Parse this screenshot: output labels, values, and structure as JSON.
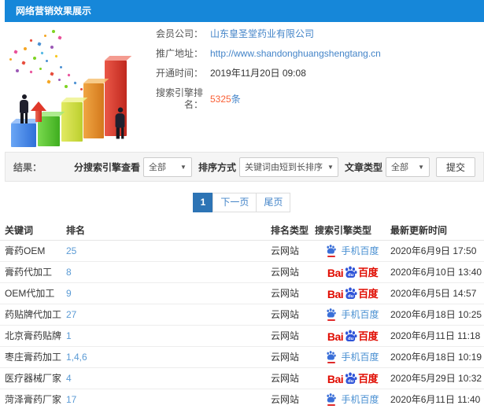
{
  "header": {
    "title": "网络营销效果展示"
  },
  "info": {
    "company_label": "会员公司：",
    "company_value": "山东皇圣堂药业有限公司",
    "url_label": "推广地址：",
    "url_value": "http://www.shandonghuangshengtang.cn",
    "opened_label": "开通时间：",
    "opened_value": "2019年11月20日 09:08",
    "rank_label": "搜索引擎排名：",
    "rank_count": "5325",
    "rank_unit": "条"
  },
  "filters": {
    "result_label": "结果：",
    "engine_label": "分搜索引擎查看",
    "engine_value": "全部",
    "sort_label": "排序方式",
    "sort_value": "关键词由短到长排序",
    "article_label": "文章类型",
    "article_value": "全部",
    "submit_label": "提交",
    "caret": "▼"
  },
  "pagination": {
    "current": "1",
    "next_label": "下一页",
    "last_label": "尾页"
  },
  "baidu": {
    "pc_prefix": "Bai",
    "paw_du": "du",
    "pc_suffix": "百度",
    "mobile_label": "手机百度"
  },
  "table": {
    "headers": [
      "关键词",
      "排名",
      "排名类型",
      "搜索引擎类型",
      "最新更新时间"
    ],
    "rows": [
      {
        "keyword": "膏药OEM",
        "rank": "25",
        "rank_type": "云网站",
        "engine": "mobile",
        "updated": "2020年6月9日 17:50"
      },
      {
        "keyword": "膏药代加工",
        "rank": "8",
        "rank_type": "云网站",
        "engine": "pc",
        "updated": "2020年6月10日 13:40"
      },
      {
        "keyword": "OEM代加工",
        "rank": "9",
        "rank_type": "云网站",
        "engine": "pc",
        "updated": "2020年6月5日 14:57"
      },
      {
        "keyword": "药贴牌代加工",
        "rank": "27",
        "rank_type": "云网站",
        "engine": "mobile",
        "updated": "2020年6月18日 10:25"
      },
      {
        "keyword": "北京膏药贴牌",
        "rank": "1",
        "rank_type": "云网站",
        "engine": "pc",
        "updated": "2020年6月11日 11:18"
      },
      {
        "keyword": "枣庄膏药加工",
        "rank": "1,4,6",
        "rank_type": "云网站",
        "engine": "mobile",
        "updated": "2020年6月18日 10:19"
      },
      {
        "keyword": "医疗器械厂家",
        "rank": "4",
        "rank_type": "云网站",
        "engine": "pc",
        "updated": "2020年5月29日 10:32"
      },
      {
        "keyword": "菏泽膏药厂家",
        "rank": "17",
        "rank_type": "云网站",
        "engine": "mobile",
        "updated": "2020年6月11日 11:40"
      }
    ]
  },
  "colors": {
    "header_bg": "#1687d9",
    "link_blue": "#4384c8",
    "rank_blue": "#5b9bd5",
    "highlight_orange": "#fa5f35",
    "pagination_active": "#2d74b5",
    "baidu_red": "#e00b00",
    "baidu_paw_blue": "#2f54d8",
    "mobile_paw_blue": "#3a6fd8",
    "filter_bg": "#f5f5f5"
  }
}
